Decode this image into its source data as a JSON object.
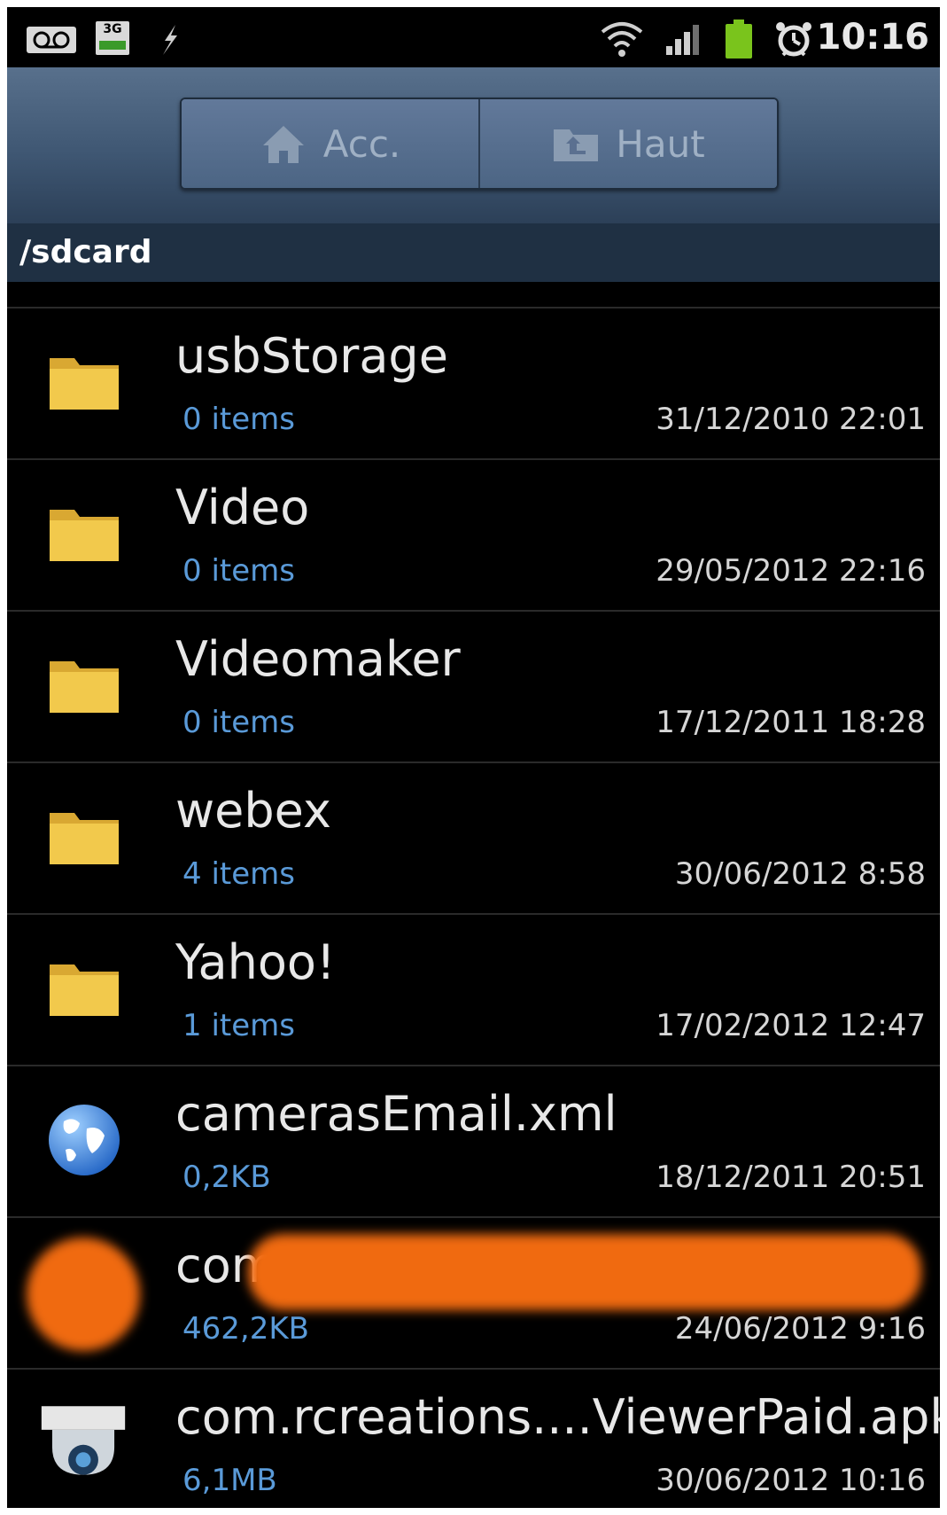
{
  "status_bar": {
    "net_label": "3G",
    "time": "10:16",
    "icons": [
      "voicemail-icon",
      "3g-icon",
      "usb-icon",
      "wifi-icon",
      "signal-icon",
      "battery-icon",
      "alarm-icon"
    ],
    "battery_color": "#7ac41c"
  },
  "toolbar": {
    "home_label": "Acc.",
    "up_label": "Haut"
  },
  "path": "/sdcard",
  "files": [
    {
      "name": "usbStorage",
      "meta": "0 items",
      "date": "31/12/2010 22:01",
      "icon": "folder-icon"
    },
    {
      "name": "Video",
      "meta": "0 items",
      "date": "29/05/2012 22:16",
      "icon": "folder-icon"
    },
    {
      "name": "Videomaker",
      "meta": "0 items",
      "date": "17/12/2011 18:28",
      "icon": "folder-icon"
    },
    {
      "name": "webex",
      "meta": "4 items",
      "date": "30/06/2012 8:58",
      "icon": "folder-icon"
    },
    {
      "name": "Yahoo!",
      "meta": "1 items",
      "date": "17/02/2012 12:47",
      "icon": "folder-icon"
    },
    {
      "name": "camerasEmail.xml",
      "meta": "0,2KB",
      "date": "18/12/2011 20:51",
      "icon": "globe-icon"
    },
    {
      "name": "com",
      "meta": "462,2KB",
      "date": "24/06/2012 9:16",
      "icon": "redacted-app-icon"
    },
    {
      "name": "com.rcreations....ViewerPaid.apk",
      "meta": "6,1MB",
      "date": "30/06/2012 10:16",
      "icon": "security-camera-icon"
    }
  ],
  "colors": {
    "meta_text": "#5a9ad8",
    "folder": "#f2c94c",
    "redaction": "#f06a10"
  }
}
